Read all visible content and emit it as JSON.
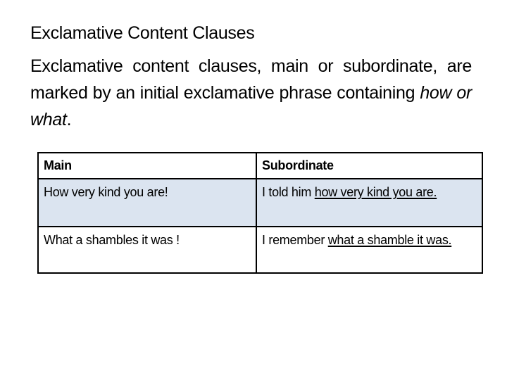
{
  "title": "Exclamative Content Clauses",
  "body": {
    "text_before": "Exclamative content clauses, main or subordinate, are marked by an initial exclamative phrase containing ",
    "text_italic": "how or what",
    "text_after": "."
  },
  "table": {
    "headers": {
      "main": "Main",
      "subordinate": "Subordinate"
    },
    "rows": [
      {
        "main": "How very kind you are!",
        "subordinate_prefix": "I told him ",
        "subordinate_underlined": "how very kind you are."
      },
      {
        "main": "What a shambles it was !",
        "subordinate_prefix": "I remember ",
        "subordinate_underlined": "what a shamble it was."
      }
    ],
    "colors": {
      "shaded_row": "#dbe4f0",
      "border": "#000000"
    }
  }
}
